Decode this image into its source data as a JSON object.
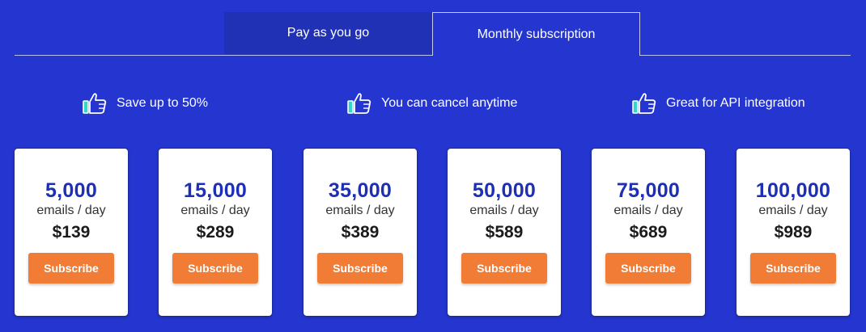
{
  "tabs": [
    {
      "label": "Pay as you go",
      "active": false
    },
    {
      "label": "Monthly subscription",
      "active": true
    }
  ],
  "features": [
    {
      "icon": "thumbs-up-icon",
      "text": "Save up to 50%"
    },
    {
      "icon": "thumbs-up-icon",
      "text": "You can cancel anytime"
    },
    {
      "icon": "thumbs-up-icon",
      "text": "Great for API integration"
    }
  ],
  "plans": [
    {
      "volume": "5,000",
      "unit": "emails / day",
      "price": "$139",
      "button": "Subscribe"
    },
    {
      "volume": "15,000",
      "unit": "emails / day",
      "price": "$289",
      "button": "Subscribe"
    },
    {
      "volume": "35,000",
      "unit": "emails / day",
      "price": "$389",
      "button": "Subscribe"
    },
    {
      "volume": "50,000",
      "unit": "emails / day",
      "price": "$589",
      "button": "Subscribe"
    },
    {
      "volume": "75,000",
      "unit": "emails / day",
      "price": "$689",
      "button": "Subscribe"
    },
    {
      "volume": "100,000",
      "unit": "emails / day",
      "price": "$989",
      "button": "Subscribe"
    }
  ],
  "colors": {
    "background": "#2436cf",
    "accent_button": "#f07c35",
    "volume_text": "#1d2eb7"
  }
}
